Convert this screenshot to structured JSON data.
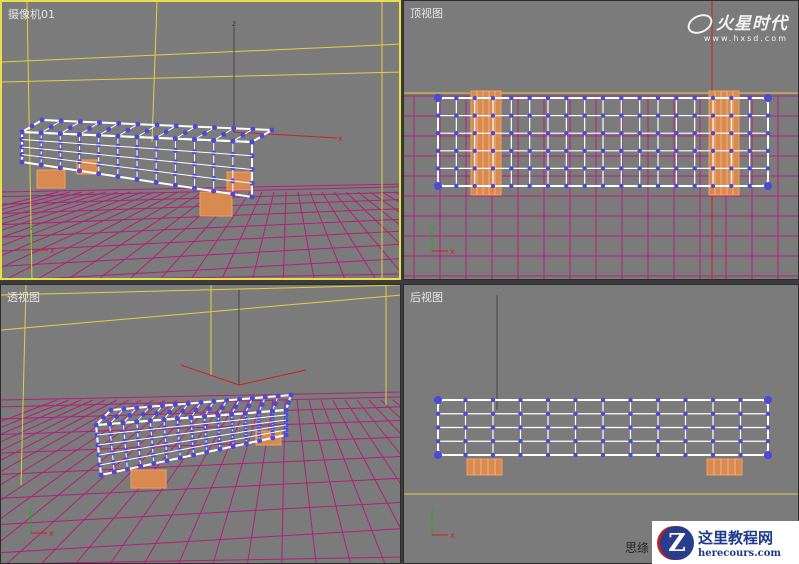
{
  "viewports": [
    {
      "id": "cam",
      "label": "摄像机01",
      "active": true
    },
    {
      "id": "top",
      "label": "顶视图",
      "active": false
    },
    {
      "id": "persp",
      "label": "透视图",
      "active": false
    },
    {
      "id": "back",
      "label": "后视图",
      "active": false
    }
  ],
  "logo": {
    "name": "火星时代",
    "url": "www.hxsd.com"
  },
  "watermark": {
    "title": "这里教程网",
    "url": "herecours.com",
    "badge": "Z"
  },
  "partial_text": "思绦",
  "axis_labels": {
    "x": "x",
    "y": "y",
    "z": "z"
  },
  "colors": {
    "viewport_bg": "#7b7b7b",
    "active_border": "#e8e04a",
    "grid": "#b0207a",
    "wire": "#ffffff",
    "vertex": "#4a4ad8",
    "legs": "#f0a060",
    "gizmo": "#cc2222"
  }
}
